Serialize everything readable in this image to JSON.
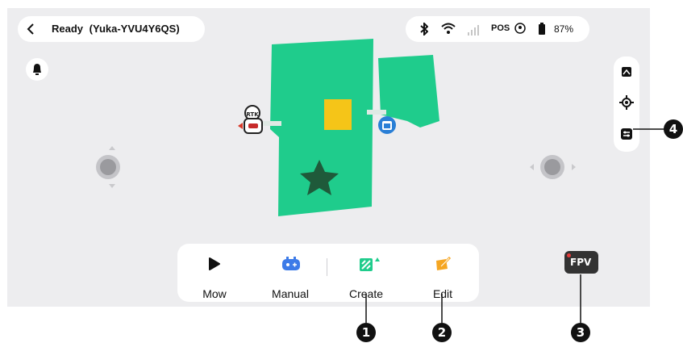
{
  "header": {
    "status_text": "Ready",
    "device_name": "(Yuka-YVU4Y6QS)"
  },
  "status_bar": {
    "pos_label": "POS",
    "battery_percent": "87%"
  },
  "bottom_bar": {
    "tabs": [
      {
        "label": "Mow"
      },
      {
        "label": "Manual"
      },
      {
        "label": "Create"
      },
      {
        "label": "Edit"
      }
    ]
  },
  "fpv": {
    "label": "FPV"
  },
  "callouts": [
    "1",
    "2",
    "3",
    "4"
  ],
  "colors": {
    "zone_green": "#1fcc8c",
    "accent_yellow": "#f5c518",
    "edit_orange": "#f5a623",
    "manual_blue": "#3d7be8"
  }
}
